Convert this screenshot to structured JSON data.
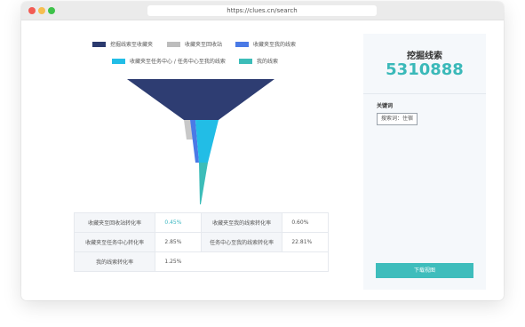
{
  "browser": {
    "url": "https://clues.cn/search"
  },
  "legend": [
    {
      "label": "挖掘线索至收藏夹",
      "color": "#2b3a6e"
    },
    {
      "label": "收藏夹至回收站",
      "color": "#bdbdbd"
    },
    {
      "label": "收藏夹至我的线索",
      "color": "#4a7ae6"
    },
    {
      "label": "收藏夹至任务中心 / 任务中心至我的线索",
      "color": "#22bde6"
    },
    {
      "label": "我的线索",
      "color": "#3cbdb9"
    }
  ],
  "funnel": {
    "colors": {
      "dark": "#2e3d72",
      "gray": "#c8c8c8",
      "blue": "#4a7ae6",
      "cyan": "#22bde6",
      "teal": "#3cbdb9"
    }
  },
  "stats": {
    "rows": [
      {
        "l1": "收藏夹至回收站转化率",
        "v1": "0.45%",
        "l2": "收藏夹至我的线索转化率",
        "v2": "0.60%"
      },
      {
        "l1": "收藏夹至任务中心转化率",
        "v1": "2.85%",
        "l2": "任务中心至我的线索转化率",
        "v2": "22.81%"
      },
      {
        "l1": "我的线索转化率",
        "v1": "1.25%"
      }
    ]
  },
  "sidebar": {
    "title": "挖掘线索",
    "count": "5310888",
    "keywords_label": "关键词",
    "keyword_tag": "搜索词：住宿",
    "download_label": "下载视图"
  }
}
